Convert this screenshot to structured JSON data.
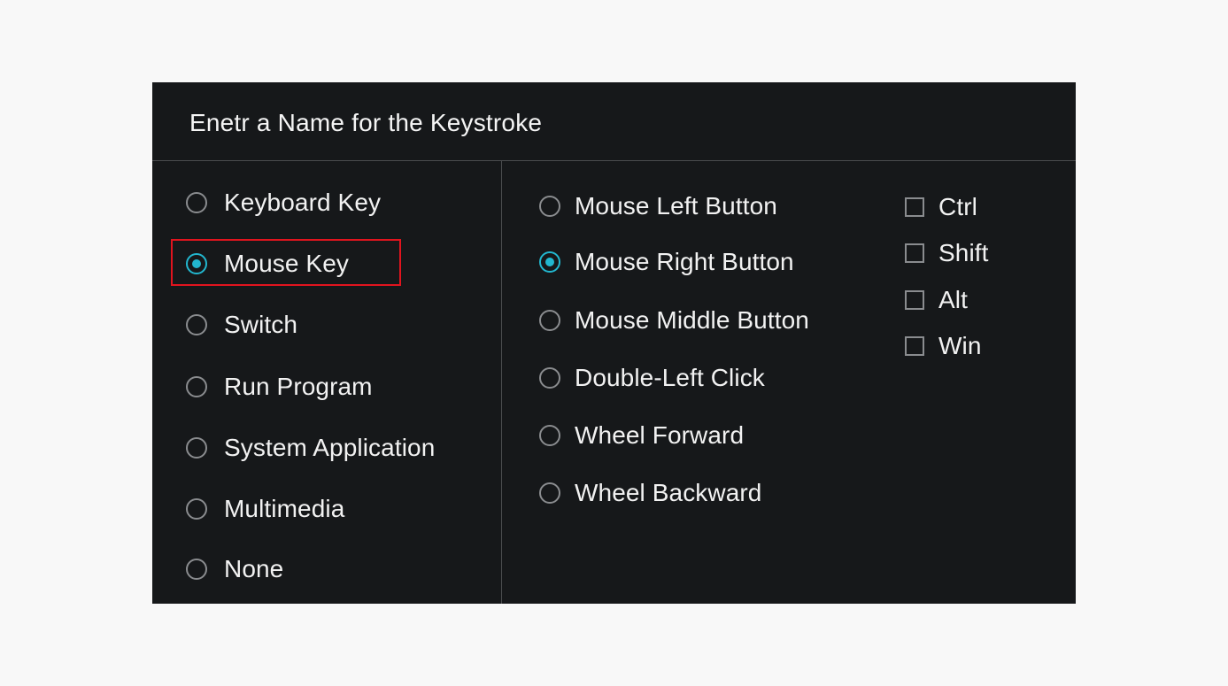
{
  "dialog": {
    "title": "Enetr a Name for the Keystroke"
  },
  "key_types": [
    {
      "label": "Keyboard Key",
      "checked": false
    },
    {
      "label": "Mouse Key",
      "checked": true
    },
    {
      "label": "Switch",
      "checked": false
    },
    {
      "label": "Run Program",
      "checked": false
    },
    {
      "label": "System Application",
      "checked": false
    },
    {
      "label": "Multimedia",
      "checked": false
    },
    {
      "label": "None",
      "checked": false
    }
  ],
  "mouse_buttons": [
    {
      "label": "Mouse Left Button",
      "checked": false
    },
    {
      "label": "Mouse Right Button",
      "checked": true
    },
    {
      "label": "Mouse Middle Button",
      "checked": false
    },
    {
      "label": "Double-Left Click",
      "checked": false
    },
    {
      "label": "Wheel Forward",
      "checked": false
    },
    {
      "label": "Wheel Backward",
      "checked": false
    }
  ],
  "modifiers": [
    {
      "label": "Ctrl",
      "checked": false
    },
    {
      "label": "Shift",
      "checked": false
    },
    {
      "label": "Alt",
      "checked": false
    },
    {
      "label": "Win",
      "checked": false
    }
  ],
  "colors": {
    "dialog_background": "#16181a",
    "accent": "#22b7cf",
    "highlight": "#e1141e",
    "divider": "#4a4c4e"
  }
}
